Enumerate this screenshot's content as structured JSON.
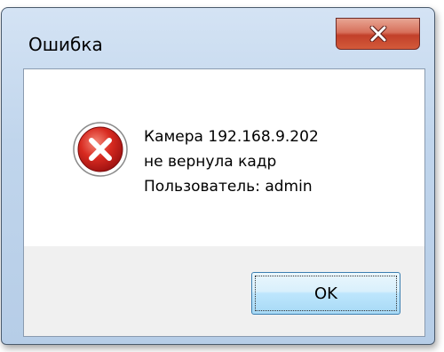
{
  "dialog": {
    "title": "Ошибка",
    "close_icon": "close-icon",
    "error_icon": "error-icon",
    "message_lines": [
      "Камера 192.168.9.202",
      "не вернула кадр",
      "Пользователь: admin"
    ],
    "ok_label": "OK"
  },
  "colors": {
    "close_button": "#c7503a",
    "error_icon": "#d21f1f",
    "ok_button_border": "#3c7fb1"
  }
}
